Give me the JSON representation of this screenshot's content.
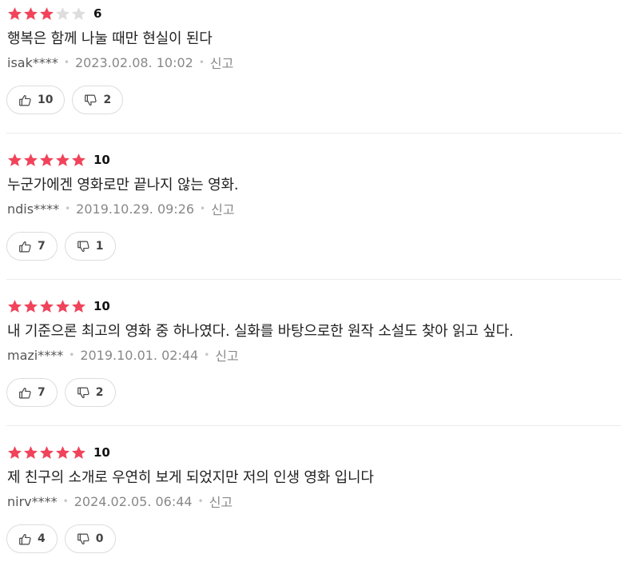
{
  "colors": {
    "star_filled": "#f1435a",
    "star_empty": "#dddddd"
  },
  "icons": {
    "like": "thumbs-up-icon",
    "dislike": "thumbs-down-icon",
    "star": "star-icon"
  },
  "reviews": [
    {
      "stars_filled": 3,
      "stars_total": 5,
      "score": "6",
      "comment": "행복은 함께 나눌 때만 현실이 된다",
      "user": "isak****",
      "date": "2023.02.08. 10:02",
      "report_label": "신고",
      "likes": "10",
      "dislikes": "2"
    },
    {
      "stars_filled": 5,
      "stars_total": 5,
      "score": "10",
      "comment": "누군가에겐 영화로만 끝나지 않는 영화.",
      "user": "ndis****",
      "date": "2019.10.29. 09:26",
      "report_label": "신고",
      "likes": "7",
      "dislikes": "1"
    },
    {
      "stars_filled": 5,
      "stars_total": 5,
      "score": "10",
      "comment": "내 기준으론 최고의 영화 중 하나였다. 실화를 바탕으로한 원작 소설도 찾아 읽고 싶다.",
      "user": "mazi****",
      "date": "2019.10.01. 02:44",
      "report_label": "신고",
      "likes": "7",
      "dislikes": "2"
    },
    {
      "stars_filled": 5,
      "stars_total": 5,
      "score": "10",
      "comment": "제 친구의 소개로 우연히 보게 되었지만 저의 인생 영화 입니다",
      "user": "nirv****",
      "date": "2024.02.05. 06:44",
      "report_label": "신고",
      "likes": "4",
      "dislikes": "0"
    }
  ]
}
